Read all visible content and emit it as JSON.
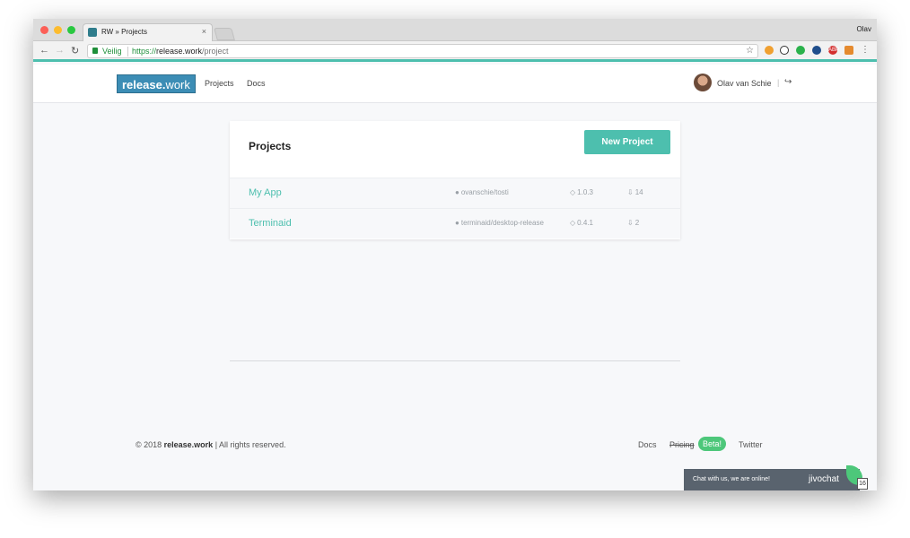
{
  "browser": {
    "tab_title": "RW » Projects",
    "tab_close": "×",
    "profile_name": "Olav",
    "secure_label": "Veilig",
    "url_scheme": "https://",
    "url_host": "release.work",
    "url_path": "/project",
    "ext_abp": "ABP"
  },
  "site": {
    "logo_bold": "release.",
    "logo_rest": "work",
    "nav": [
      "Projects",
      "Docs"
    ],
    "user_name": "Olav van Schie",
    "pipe": "|"
  },
  "projects": {
    "title": "Projects",
    "new_button": "New Project",
    "items": [
      {
        "name": "My App",
        "repo": "ovanschie/tosti",
        "version": "1.0.3",
        "count": "14"
      },
      {
        "name": "Terminaid",
        "repo": "terminaid/desktop-release",
        "version": "0.4.1",
        "count": "2"
      }
    ]
  },
  "footer": {
    "copy_prefix": "© 2018 ",
    "copy_brand": "release.work",
    "copy_suffix": " | All rights reserved.",
    "links": {
      "docs": "Docs",
      "pricing": "Pricing",
      "beta": "Beta!",
      "twitter": "Twitter"
    }
  },
  "chat": {
    "message": "Chat with us, we are online!",
    "brand": "jivochat",
    "badge": "16"
  },
  "colors": {
    "accent": "#4dbfae",
    "logo_bg": "#3c8db5",
    "beta": "#4dc77a"
  }
}
